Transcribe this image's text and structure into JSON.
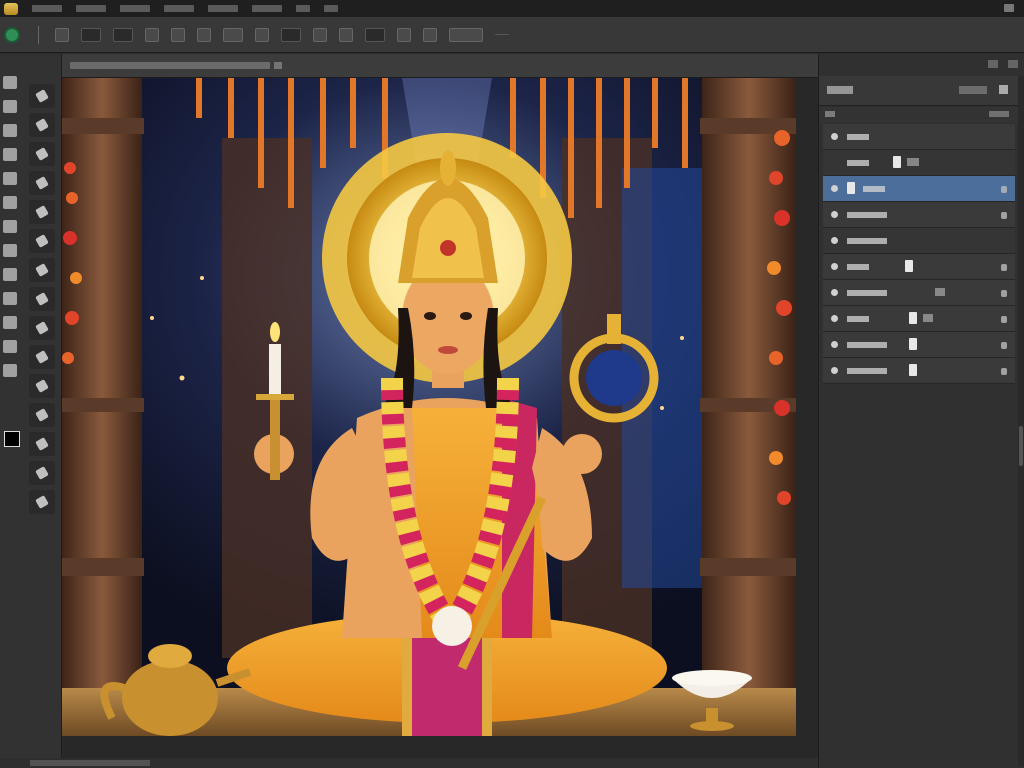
{
  "menubar": {
    "items": [
      {
        "label": ""
      },
      {
        "label": ""
      },
      {
        "label": ""
      },
      {
        "label": ""
      },
      {
        "label": ""
      },
      {
        "label": ""
      },
      {
        "label": ""
      },
      {
        "label": ""
      },
      {
        "label": ""
      }
    ]
  },
  "document": {
    "tab_label": ""
  },
  "layers_panel": {
    "tab_label": "",
    "layers": [
      {
        "name": "",
        "selected": false
      },
      {
        "name": "",
        "selected": false
      },
      {
        "name": "",
        "selected": true
      },
      {
        "name": "",
        "selected": false
      },
      {
        "name": "",
        "selected": false
      },
      {
        "name": "",
        "selected": false
      },
      {
        "name": "",
        "selected": false
      },
      {
        "name": "",
        "selected": false
      },
      {
        "name": "",
        "selected": false
      },
      {
        "name": "",
        "selected": false
      }
    ]
  },
  "colors": {
    "foreground_swatch": "#000000",
    "selected_layer": "#4b6e9b",
    "panel_bg": "#303030",
    "app_bg": "#2b2b2b"
  },
  "canvas_image": {
    "icons": [
      "deity-figure",
      "sun-halo",
      "crown",
      "candle",
      "scepter",
      "flower-garland",
      "brass-pot",
      "offering-bowl",
      "temple-pillar",
      "hanging-lamps"
    ]
  }
}
